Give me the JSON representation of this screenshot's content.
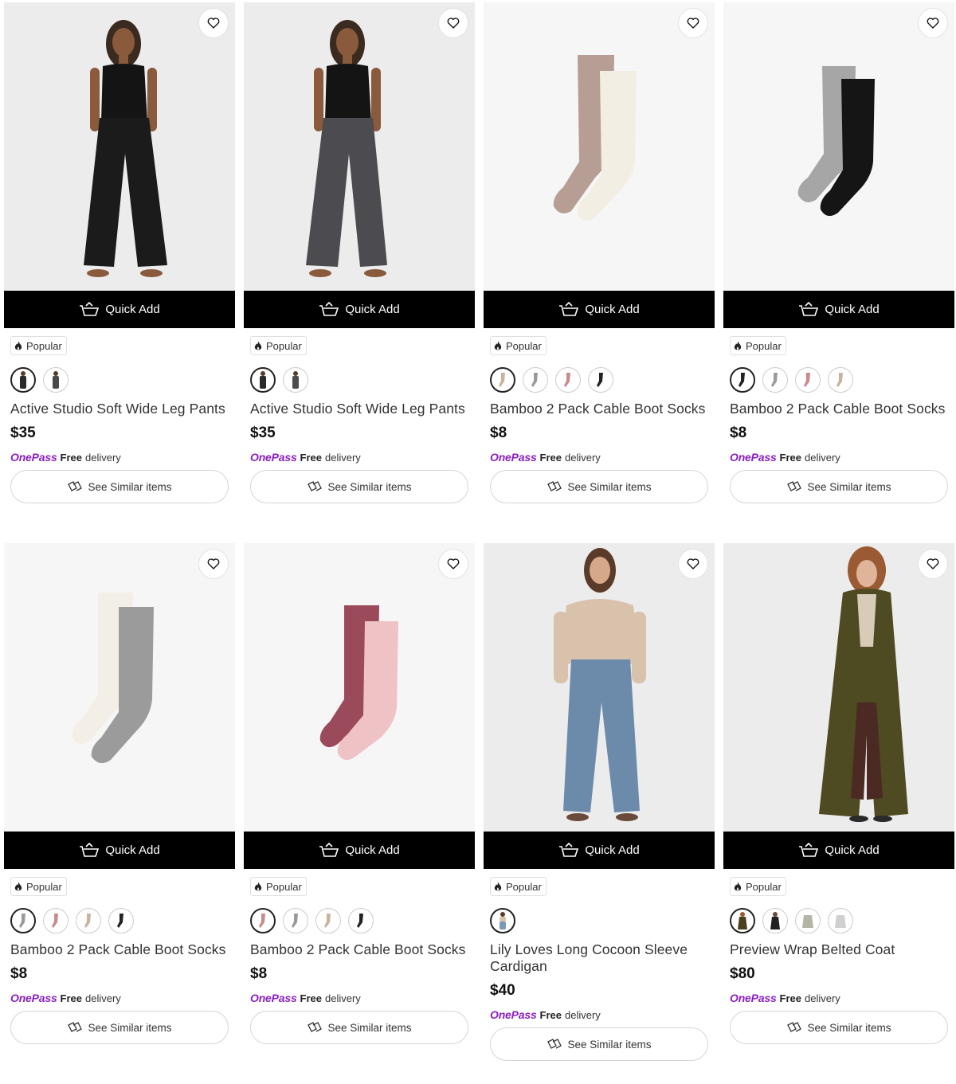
{
  "common": {
    "quick_add": "Quick Add",
    "popular": "Popular",
    "onepass": "OnePass",
    "free": "Free",
    "delivery": "delivery",
    "see_similar": "See Similar items"
  },
  "products": [
    {
      "title": "Active Studio Soft Wide Leg Pants",
      "price": "$35",
      "swatch_colors": [
        "#2a2a2a",
        "#4a4a4a"
      ],
      "image": "model-black-pants"
    },
    {
      "title": "Active Studio Soft Wide Leg Pants",
      "price": "$35",
      "swatch_colors": [
        "#2a2a2a",
        "#4d4d4d"
      ],
      "image": "model-grey-pants"
    },
    {
      "title": "Bamboo 2 Pack Cable Boot Socks",
      "price": "$8",
      "swatch_colors": [
        "#c8b49c",
        "#9a9a9a",
        "#c98a8c",
        "#222222"
      ],
      "image": "socks-mauve-cream"
    },
    {
      "title": "Bamboo 2 Pack Cable Boot Socks",
      "price": "$8",
      "swatch_colors": [
        "#222222",
        "#9a9a9a",
        "#c98a8c",
        "#c8b49c"
      ],
      "image": "socks-grey-black"
    },
    {
      "title": "Bamboo 2 Pack Cable Boot Socks",
      "price": "$8",
      "swatch_colors": [
        "#9a9a9a",
        "#c98a8c",
        "#c8b49c",
        "#222222"
      ],
      "image": "socks-cream-grey"
    },
    {
      "title": "Bamboo 2 Pack Cable Boot Socks",
      "price": "$8",
      "swatch_colors": [
        "#c98a8c",
        "#9a9a9a",
        "#c8b49c",
        "#222222"
      ],
      "image": "socks-berry-pink"
    },
    {
      "title": "Lily Loves Long Cocoon Sleeve Cardigan",
      "price": "$40",
      "swatch_colors": [
        "#7a98b8"
      ],
      "image": "model-beige-cardigan"
    },
    {
      "title": "Preview Wrap Belted Coat",
      "price": "$80",
      "swatch_colors": [
        "#4a3f1e",
        "#222222",
        "#b5b5a5",
        "#d0d0d0"
      ],
      "image": "model-olive-coat"
    }
  ]
}
